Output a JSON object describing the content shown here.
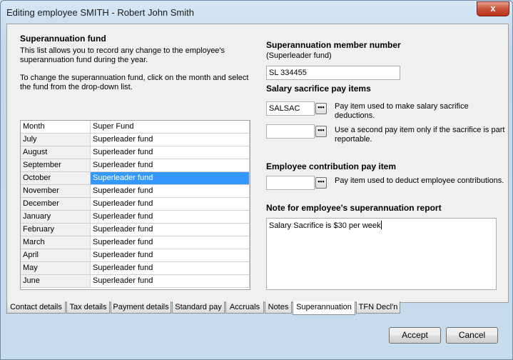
{
  "window": {
    "title": "Editing employee SMITH - Robert John Smith",
    "close_label": "x"
  },
  "fund_section": {
    "heading": "Superannuation fund",
    "desc_line1": "This list allows you to record any change to the employee's",
    "desc_line2": "superannuation fund during the year.",
    "instr_line1": "To change the superannuation fund, click on the month and select",
    "instr_line2": "the fund from the drop-down list."
  },
  "grid": {
    "headers": [
      "Month",
      "Super Fund"
    ],
    "rows": [
      {
        "month": "July",
        "fund": "Superleader fund"
      },
      {
        "month": "August",
        "fund": "Superleader fund"
      },
      {
        "month": "September",
        "fund": "Superleader fund"
      },
      {
        "month": "October",
        "fund": "Superleader fund"
      },
      {
        "month": "November",
        "fund": "Superleader fund"
      },
      {
        "month": "December",
        "fund": "Superleader fund"
      },
      {
        "month": "January",
        "fund": "Superleader fund"
      },
      {
        "month": "February",
        "fund": "Superleader fund"
      },
      {
        "month": "March",
        "fund": "Superleader fund"
      },
      {
        "month": "April",
        "fund": "Superleader fund"
      },
      {
        "month": "May",
        "fund": "Superleader fund"
      },
      {
        "month": "June",
        "fund": "Superleader fund"
      }
    ],
    "selected_month": "October"
  },
  "member": {
    "heading": "Superannuation member number",
    "sub": "(Superleader fund)",
    "value": "SL 334455"
  },
  "salary_sacrifice": {
    "heading": "Salary sacrifice pay items",
    "item1_value": "SALSAC",
    "item1_desc_line1": "Pay item used to make salary sacrifice",
    "item1_desc_line2": "deductions.",
    "item2_value": "",
    "item2_desc_line1": "Use a second pay item only if the sacrifice is part",
    "item2_desc_line2": "reportable."
  },
  "employee_contribution": {
    "heading": "Employee contribution pay item",
    "value": "",
    "desc": "Pay item used to deduct employee contributions."
  },
  "note": {
    "heading": "Note for employee's superannuation report",
    "value": "Salary Sacrifice is $30 per week"
  },
  "ellipsis_label": "•••",
  "tabs": [
    {
      "label": "Contact details"
    },
    {
      "label": "Tax details"
    },
    {
      "label": "Payment details"
    },
    {
      "label": "Standard pay"
    },
    {
      "label": "Accruals"
    },
    {
      "label": "Notes"
    },
    {
      "label": "Superannuation"
    },
    {
      "label": "TFN Decl'n"
    }
  ],
  "active_tab": "Superannuation",
  "buttons": {
    "accept": "Accept",
    "cancel": "Cancel"
  },
  "colors": {
    "selection": "#3399ff",
    "close": "#c9533a"
  }
}
